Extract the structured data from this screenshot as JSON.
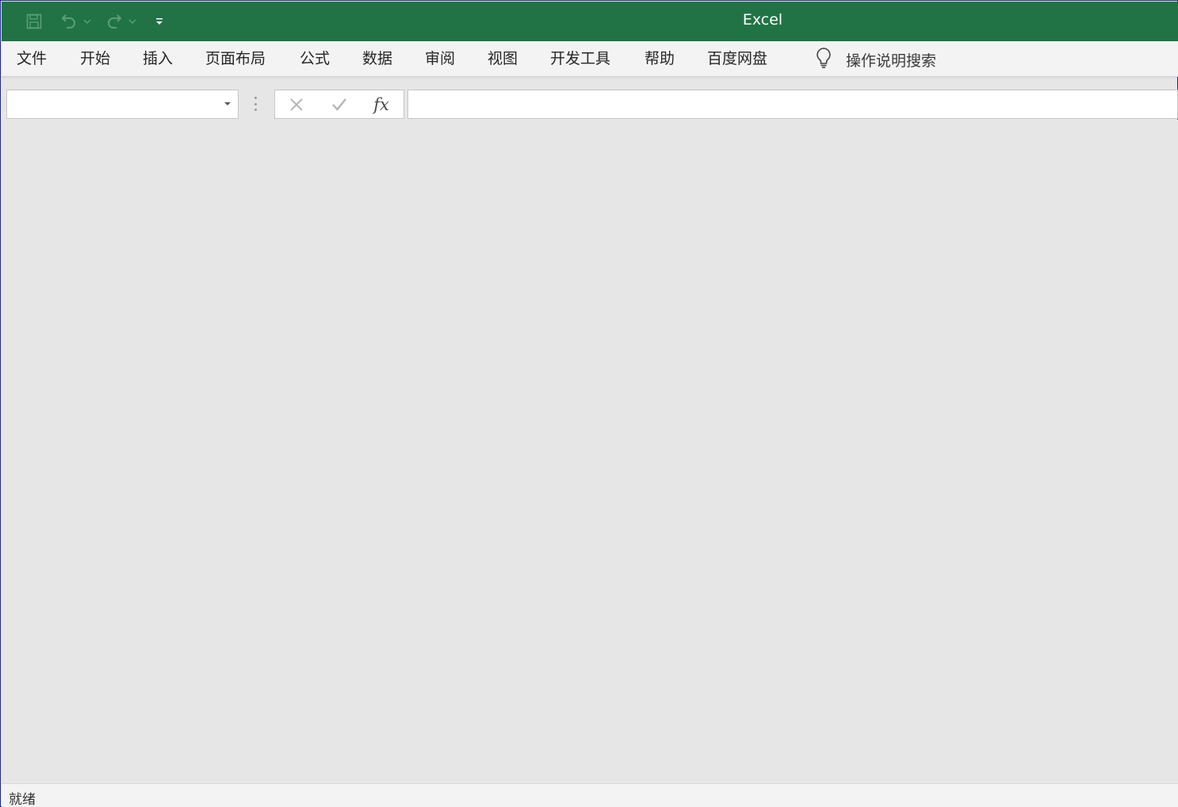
{
  "app": {
    "title": "Excel"
  },
  "quick_access": [
    {
      "name": "save-icon"
    },
    {
      "name": "undo-icon"
    },
    {
      "name": "redo-icon"
    },
    {
      "name": "customize-qat-icon"
    }
  ],
  "ribbon": {
    "tabs": [
      {
        "label": "文件"
      },
      {
        "label": "开始"
      },
      {
        "label": "插入"
      },
      {
        "label": "页面布局"
      },
      {
        "label": "公式"
      },
      {
        "label": "数据"
      },
      {
        "label": "审阅"
      },
      {
        "label": "视图"
      },
      {
        "label": "开发工具"
      },
      {
        "label": "帮助"
      },
      {
        "label": "百度网盘"
      }
    ],
    "tell_me": {
      "icon": "lightbulb-icon",
      "label": "操作说明搜索"
    }
  },
  "formula_bar": {
    "name_box_value": "",
    "fx_label": "fx",
    "formula_value": ""
  },
  "status_bar": {
    "status": "就绪"
  },
  "colors": {
    "titlebar": "#217346",
    "ribbon_bg": "#f3f3f3",
    "workspace_bg": "#e6e6e6"
  }
}
